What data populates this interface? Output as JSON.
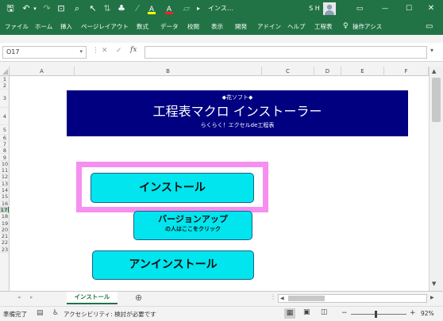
{
  "titlebar": {
    "doc_title": "インス…",
    "user_initials": "S H",
    "save_glyph": "🖫",
    "undo_glyph": "↶",
    "redo_glyph": "↷",
    "minimize_glyph": "—",
    "restore_glyph": "☐",
    "close_glyph": "✕",
    "ribbon_display_glyph": "▭"
  },
  "ribbon": {
    "tabs": [
      "ファイル",
      "ホーム",
      "挿入",
      "ページレイアウト",
      "数式",
      "データ",
      "校閲",
      "表示",
      "開発",
      "アドイン",
      "ヘルプ",
      "工程表"
    ],
    "tell_me": "操作アシス",
    "search_glyph": "♀",
    "comment_glyph": "▭"
  },
  "formula_bar": {
    "name_box": "O17",
    "cancel_glyph": "✕",
    "enter_glyph": "✓",
    "fx_label": "fx",
    "value": ""
  },
  "columns": [
    "A",
    "B",
    "C",
    "D",
    "E",
    "F"
  ],
  "rows": [
    "1",
    "2",
    "3",
    "4",
    "5",
    "6",
    "7",
    "8",
    "9",
    "10",
    "11",
    "12",
    "13",
    "14",
    "15",
    "16",
    "17",
    "18",
    "19",
    "20",
    "21",
    "22",
    "23"
  ],
  "banner": {
    "top_line": "◆花ソフト◆",
    "title": "工程表マクロ インストーラー",
    "subtitle": "らくらく！エクセルde工程表"
  },
  "buttons": {
    "install": "インストール",
    "version_up_line1": "バージョンアップ",
    "version_up_line2": "の人はここをクリック",
    "uninstall": "アンインストール"
  },
  "colors": {
    "excel_green": "#217346",
    "banner_navy": "#000080",
    "button_cyan": "#00e5ee",
    "highlight_pink": "#f590f0"
  },
  "sheet_tabs": {
    "active": "インストール",
    "add_glyph": "⊕"
  },
  "status": {
    "ready": "準備完了",
    "accessibility": "アクセシビリティ: 検討が必要です",
    "zoom": "92%"
  }
}
